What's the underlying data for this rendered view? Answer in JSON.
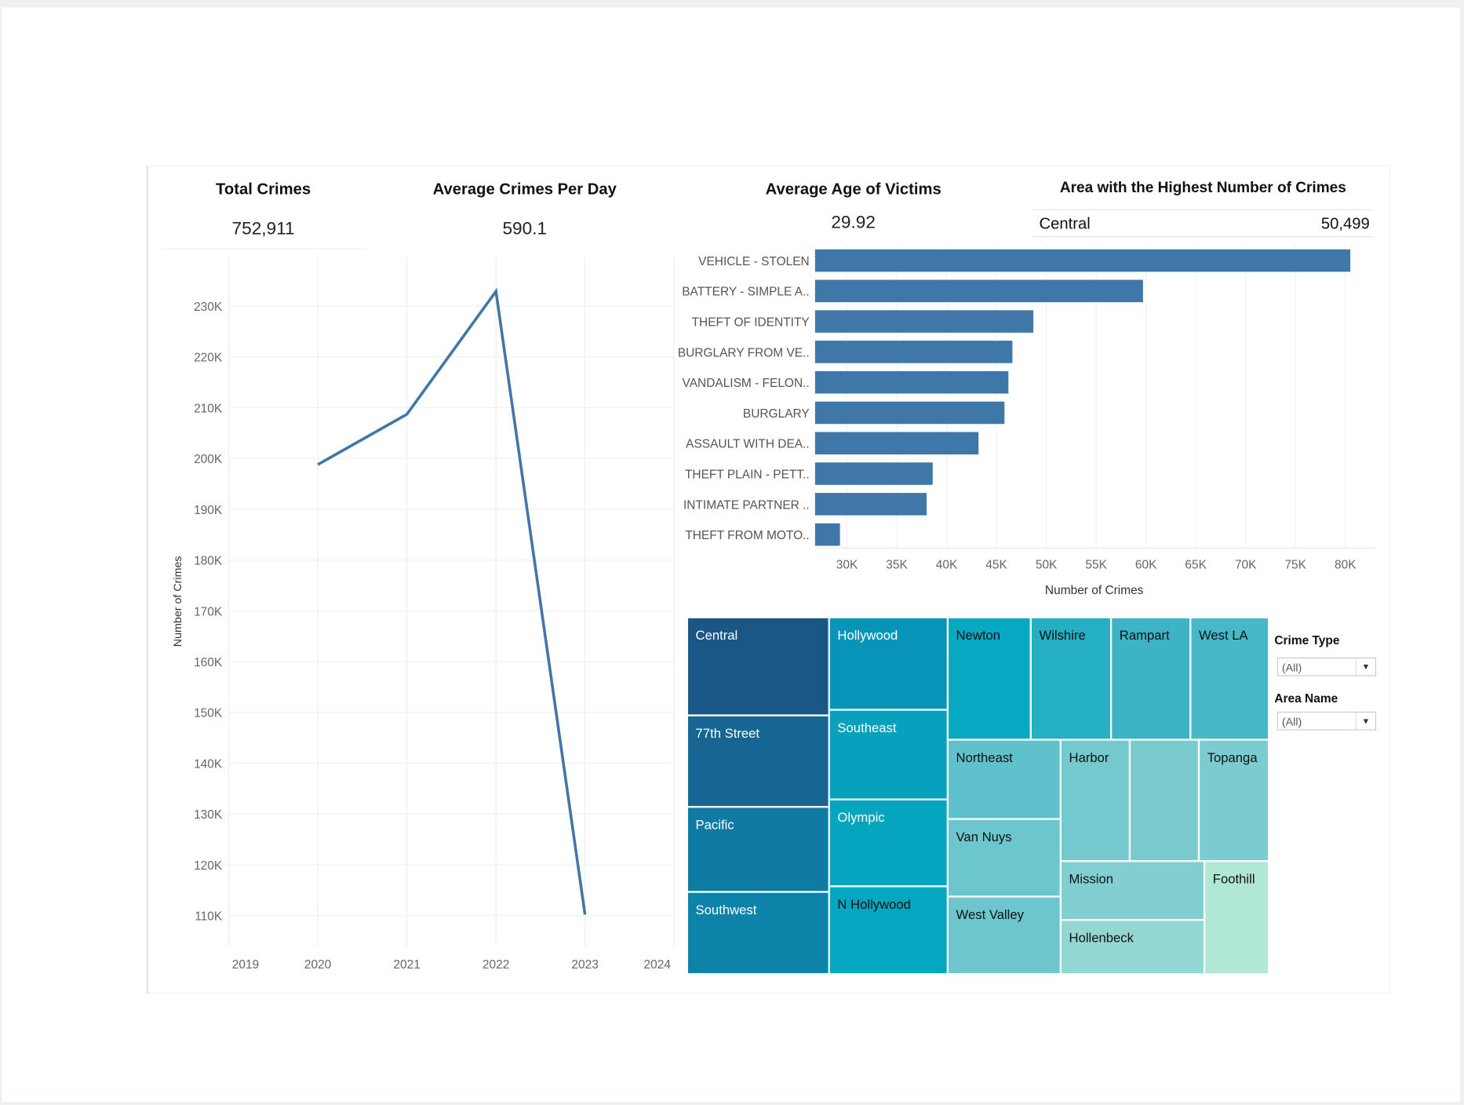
{
  "kpis": {
    "total_crimes": {
      "title": "Total Crimes",
      "value": "752,911"
    },
    "avg_per_day": {
      "title": "Average Crimes Per Day",
      "value": "590.1"
    },
    "avg_age": {
      "title": "Average Age of Victims",
      "value": "29.92"
    },
    "top_area": {
      "title": "Area with the Highest Number of Crimes",
      "area": "Central",
      "value": "50,499"
    }
  },
  "filters": {
    "crime_type": {
      "label": "Crime Type",
      "value": "(All)"
    },
    "area_name": {
      "label": "Area Name",
      "value": "(All)"
    }
  },
  "colors": {
    "bar": "#3f77a8",
    "line": "#3f77a8"
  },
  "chart_data": [
    {
      "type": "line",
      "x": [
        2020,
        2021,
        2022,
        2023
      ],
      "y": [
        198800,
        208700,
        232900,
        110200
      ],
      "xticks": [
        "2019",
        "2020",
        "2021",
        "2022",
        "2023",
        "2024"
      ],
      "yticks": [
        "110K",
        "120K",
        "130K",
        "140K",
        "150K",
        "160K",
        "170K",
        "180K",
        "190K",
        "200K",
        "210K",
        "220K",
        "230K"
      ],
      "xlim": [
        2019,
        2024
      ],
      "ylim": [
        104000,
        239700
      ],
      "ylabel": "Number of Crimes",
      "xlabel": "",
      "grid": true
    },
    {
      "type": "bar",
      "orientation": "horizontal",
      "categories": [
        "VEHICLE - STOLEN",
        "BATTERY - SIMPLE A..",
        "THEFT OF IDENTITY",
        "BURGLARY FROM VE..",
        "VANDALISM - FELON..",
        "BURGLARY",
        "ASSAULT WITH DEA..",
        "THEFT PLAIN - PETT..",
        "INTIMATE PARTNER ..",
        "THEFT FROM MOTO.."
      ],
      "values": [
        80500,
        59700,
        48700,
        46600,
        46200,
        45800,
        43200,
        38600,
        38000,
        29300
      ],
      "xticks": [
        "30K",
        "35K",
        "40K",
        "45K",
        "50K",
        "55K",
        "60K",
        "65K",
        "70K",
        "75K",
        "80K"
      ],
      "xlim": [
        26800,
        83000
      ],
      "xlabel": "Number of Crimes",
      "grid": true
    },
    {
      "type": "treemap",
      "tiles": [
        {
          "name": "Central",
          "color": "#1a5787",
          "text": "#fff"
        },
        {
          "name": "77th Street",
          "color": "#176592",
          "text": "#fff"
        },
        {
          "name": "Pacific",
          "color": "#0f7aa3",
          "text": "#fff"
        },
        {
          "name": "Southwest",
          "color": "#0d83aa",
          "text": "#fff"
        },
        {
          "name": "Hollywood",
          "color": "#0893b8",
          "text": "#fff"
        },
        {
          "name": "Southeast",
          "color": "#07a0bd",
          "text": "#fff"
        },
        {
          "name": "Olympic",
          "color": "#05a5bf",
          "text": "#fff"
        },
        {
          "name": "N Hollywood",
          "color": "#03a8c0",
          "text": "#111"
        },
        {
          "name": "Newton",
          "color": "#06a9c1",
          "text": "#111"
        },
        {
          "name": "Wilshire",
          "color": "#25afc3",
          "text": "#111"
        },
        {
          "name": "Rampart",
          "color": "#3cb4c5",
          "text": "#111"
        },
        {
          "name": "West LA",
          "color": "#46b8c8",
          "text": "#111"
        },
        {
          "name": "Northeast",
          "color": "#5fc1cc",
          "text": "#111"
        },
        {
          "name": "Van Nuys",
          "color": "#6bc6cd",
          "text": "#111"
        },
        {
          "name": "West Valley",
          "color": "#6dc6ce",
          "text": "#111"
        },
        {
          "name": "Harbor",
          "color": "#74c9cf",
          "text": "#111"
        },
        {
          "name": "",
          "color": "#79cbd0",
          "text": "#111"
        },
        {
          "name": "Topanga",
          "color": "#7accd0",
          "text": "#111"
        },
        {
          "name": "Mission",
          "color": "#82cfd1",
          "text": "#111"
        },
        {
          "name": "Hollenbeck",
          "color": "#93d6d2",
          "text": "#111"
        },
        {
          "name": "Foothill",
          "color": "#b1e8d5",
          "text": "#111"
        }
      ]
    }
  ]
}
